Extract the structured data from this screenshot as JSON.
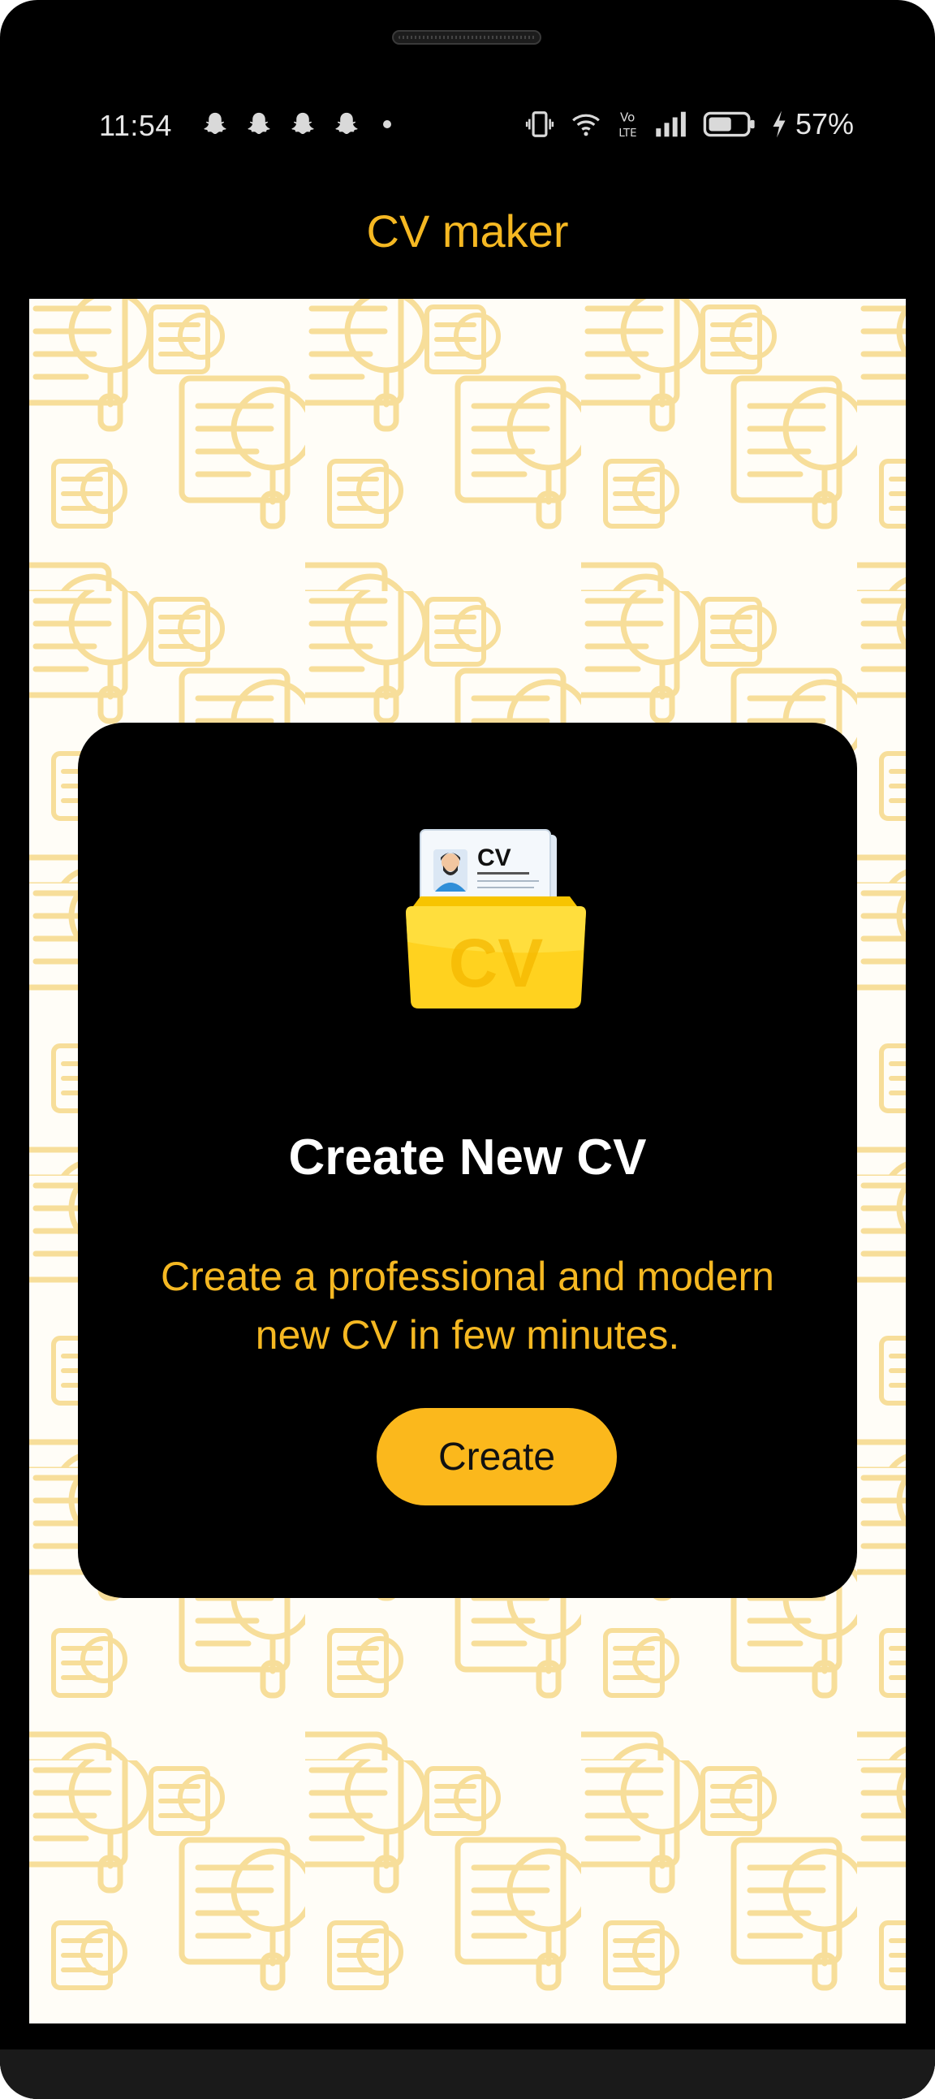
{
  "status_bar": {
    "time": "11:54",
    "battery_percent": "57%",
    "notification_icons": [
      "snapchat-icon",
      "snapchat-icon",
      "snapchat-icon",
      "snapchat-icon"
    ],
    "right_icons": [
      "vibrate-icon",
      "wifi-icon",
      "volte-icon",
      "signal-icon",
      "battery-icon",
      "charging-icon"
    ]
  },
  "app_bar": {
    "title": "CV maker"
  },
  "card": {
    "illustration_label": "CV",
    "title": "Create New CV",
    "description": "Create a professional and modern new CV in few minutes.",
    "button_label": "Create"
  },
  "colors": {
    "accent": "#fbb81c",
    "title_text": "#f5b822",
    "card_background": "#000000",
    "pattern": "#f6d98a"
  }
}
